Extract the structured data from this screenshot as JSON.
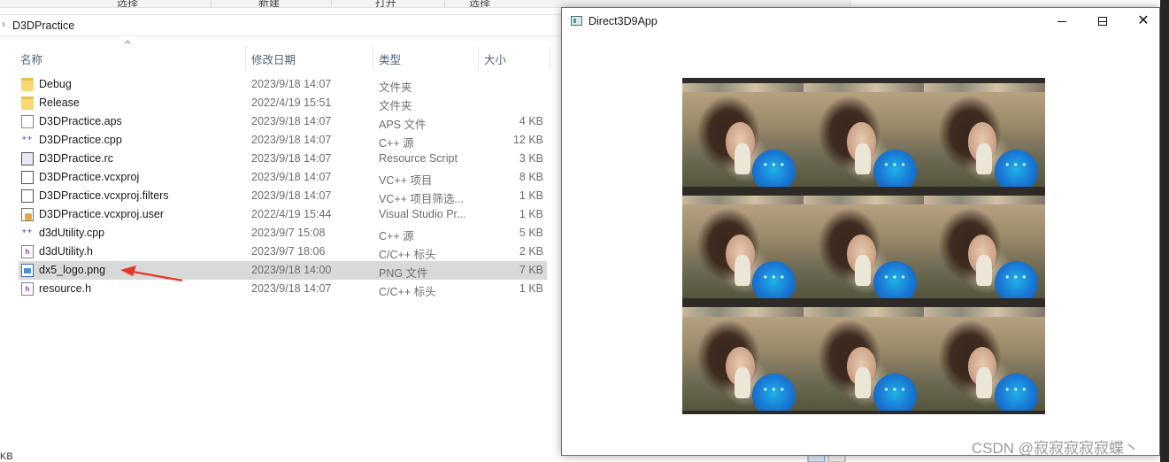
{
  "explorer": {
    "top_tabs": [
      "选择",
      "新建",
      "打开",
      "选择"
    ],
    "breadcrumb": "D3DPractice",
    "columns": {
      "name": "名称",
      "date": "修改日期",
      "type": "类型",
      "size": "大小"
    },
    "files": [
      {
        "name": "Debug",
        "date": "2023/9/18 14:07",
        "type": "文件夹",
        "size": "",
        "icon": "folder-icon"
      },
      {
        "name": "Release",
        "date": "2022/4/19 15:51",
        "type": "文件夹",
        "size": "",
        "icon": "folder-icon"
      },
      {
        "name": "D3DPractice.aps",
        "date": "2023/9/18 14:07",
        "type": "APS 文件",
        "size": "4 KB",
        "icon": "file-icon"
      },
      {
        "name": "D3DPractice.cpp",
        "date": "2023/9/18 14:07",
        "type": "C++ 源",
        "size": "12 KB",
        "icon": "cpp-file-icon"
      },
      {
        "name": "D3DPractice.rc",
        "date": "2023/9/18 14:07",
        "type": "Resource Script",
        "size": "3 KB",
        "icon": "resource-script-icon"
      },
      {
        "name": "D3DPractice.vcxproj",
        "date": "2023/9/18 14:07",
        "type": "VC++ 项目",
        "size": "8 KB",
        "icon": "vcxproj-icon"
      },
      {
        "name": "D3DPractice.vcxproj.filters",
        "date": "2023/9/18 14:07",
        "type": "VC++ 项目筛选...",
        "size": "1 KB",
        "icon": "filters-file-icon"
      },
      {
        "name": "D3DPractice.vcxproj.user",
        "date": "2022/4/19 15:44",
        "type": "Visual Studio Pr...",
        "size": "1 KB",
        "icon": "user-file-icon"
      },
      {
        "name": "d3dUtility.cpp",
        "date": "2023/9/7 15:08",
        "type": "C++ 源",
        "size": "5 KB",
        "icon": "cpp-file-icon"
      },
      {
        "name": "d3dUtility.h",
        "date": "2023/9/7 18:06",
        "type": "C/C++ 标头",
        "size": "2 KB",
        "icon": "header-file-icon"
      },
      {
        "name": "dx5_logo.png",
        "date": "2023/9/18 14:00",
        "type": "PNG 文件",
        "size": "7 KB",
        "icon": "png-file-icon",
        "selected": true
      },
      {
        "name": "resource.h",
        "date": "2023/9/18 14:07",
        "type": "C/C++ 标头",
        "size": "1 KB",
        "icon": "header-file-icon"
      }
    ],
    "status_text": "KB",
    "annotation_arrow_color": "#e8352a",
    "selection_color": "#d9d9d9"
  },
  "app_window": {
    "title": "Direct3D9App",
    "buttons": {
      "minimize": "minimize",
      "maximize": "maximize",
      "close": "close"
    },
    "render_grid": {
      "rows": 3,
      "cols": 3,
      "texture": "dx5_logo.png"
    }
  },
  "watermark": "CSDN @寂寂寂寂寂蝶丶"
}
